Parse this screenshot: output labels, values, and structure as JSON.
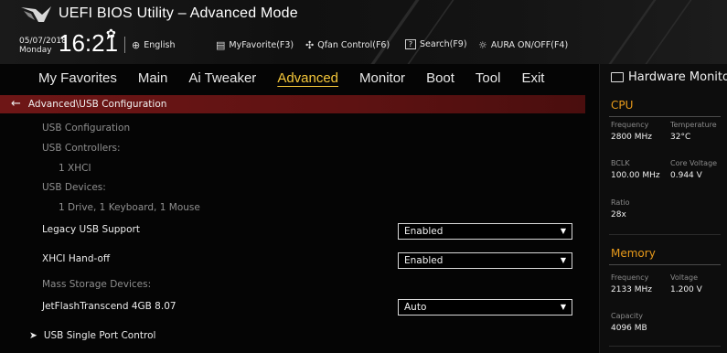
{
  "header": {
    "title": "UEFI BIOS Utility – Advanced Mode",
    "date": "05/07/2018",
    "day": "Monday",
    "time": "16:21",
    "buttons": {
      "language": "English",
      "myfavorite": "MyFavorite(F3)",
      "qfan": "Qfan Control(F6)",
      "search": "Search(F9)",
      "aura": "AURA ON/OFF(F4)"
    }
  },
  "tabs": [
    "My Favorites",
    "Main",
    "Ai Tweaker",
    "Advanced",
    "Monitor",
    "Boot",
    "Tool",
    "Exit"
  ],
  "active_tab": "Advanced",
  "main": {
    "breadcrumb": "Advanced\\USB Configuration",
    "usb_configuration": "USB Configuration",
    "usb_controllers_label": "USB Controllers:",
    "usb_controllers_value": "1 XHCI",
    "usb_devices_label": "USB Devices:",
    "usb_devices_value": "1 Drive, 1 Keyboard, 1 Mouse",
    "legacy_usb": {
      "label": "Legacy USB Support",
      "value": "Enabled"
    },
    "xhci_handoff": {
      "label": "XHCI Hand-off",
      "value": "Enabled"
    },
    "mass_storage_label": "Mass Storage Devices:",
    "jetflash": {
      "label": "JetFlashTranscend 4GB 8.07",
      "value": "Auto"
    },
    "single_port": "USB Single Port Control"
  },
  "hardware_monitor": {
    "title": "Hardware Monitor",
    "cpu": {
      "section": "CPU",
      "frequency_label": "Frequency",
      "frequency_value": "2800 MHz",
      "temperature_label": "Temperature",
      "temperature_value": "32°C",
      "bclk_label": "BCLK",
      "bclk_value": "100.00 MHz",
      "core_voltage_label": "Core Voltage",
      "core_voltage_value": "0.944 V",
      "ratio_label": "Ratio",
      "ratio_value": "28x"
    },
    "memory": {
      "section": "Memory",
      "frequency_label": "Frequency",
      "frequency_value": "2133 MHz",
      "voltage_label": "Voltage",
      "voltage_value": "1.200 V",
      "capacity_label": "Capacity",
      "capacity_value": "4096 MB"
    }
  },
  "colors": {
    "accent_active_tab": "#f5c73a",
    "breadcrumb_bar": "#6e1616",
    "section_header": "#e89a1a"
  },
  "icons": [
    "rog-logo-icon",
    "gear-icon",
    "globe-icon",
    "favorite-icon",
    "fan-icon",
    "search-icon",
    "aura-icon",
    "back-arrow-icon",
    "chevron-down-icon",
    "submenu-arrow-icon",
    "monitor-icon"
  ]
}
